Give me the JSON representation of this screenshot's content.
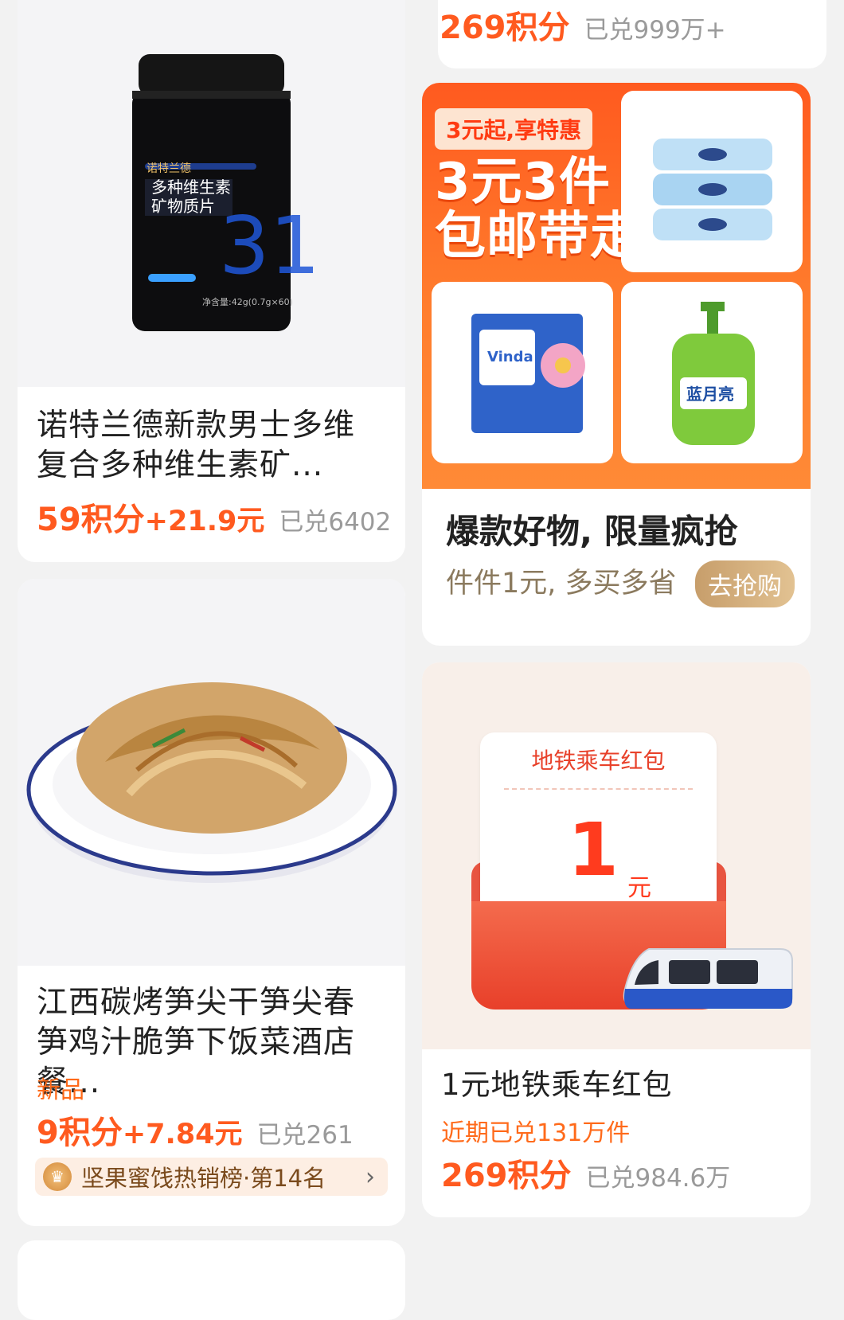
{
  "cards": {
    "topRight": {
      "points": "269积分",
      "sold": "已兑999万+"
    },
    "vitamin": {
      "title": "诺特兰德新款男士多维复合多种维生素矿...",
      "pts": "59积分",
      "cash": "+21.9元",
      "sold": "已兑6402",
      "jar_brand": "诺特兰德",
      "jar_line1": "多种维生素",
      "jar_line2": "矿物质片",
      "jar_num": "31",
      "jar_net": "净含量:42g(0.7g×60)"
    },
    "deal": {
      "tag": "3元起,享特惠",
      "line1": "3元3件",
      "line2": "包邮带走",
      "heading": "爆款好物, 限量疯抢",
      "sub": "件件1元, 多买多省",
      "button": "去抢购",
      "product_brands": [
        "Vinda",
        "蓝月亮"
      ]
    },
    "noodle": {
      "title": "江西碳烤笋尖干笋尖春笋鸡汁脆笋下饭菜酒店餐...",
      "tag": "新品",
      "pts": "9积分",
      "cash": "+7.84元",
      "sold": "已兑261",
      "rank": "坚果蜜饯热销榜·第14名"
    },
    "metro": {
      "ticket_title": "地铁乘车红包",
      "ticket_value": "1",
      "ticket_unit": "元",
      "title": "1元地铁乘车红包",
      "recent": "近期已兑131万件",
      "points": "269积分",
      "sold": "已兑984.6万"
    }
  },
  "colors": {
    "accent": "#ff5a1f",
    "muted": "#9a9a9a",
    "gold": "#c79e6b"
  }
}
